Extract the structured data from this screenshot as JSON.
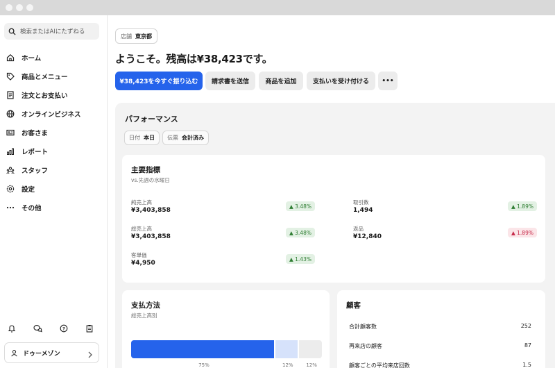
{
  "sidebar": {
    "search_placeholder": "検索またはAIにたずねる",
    "items": [
      {
        "label": "ホーム",
        "icon": "home-icon"
      },
      {
        "label": "商品とメニュー",
        "icon": "tag-icon"
      },
      {
        "label": "注文とお支払い",
        "icon": "receipt-icon"
      },
      {
        "label": "オンラインビジネス",
        "icon": "globe-icon"
      },
      {
        "label": "お客さま",
        "icon": "id-card-icon"
      },
      {
        "label": "レポート",
        "icon": "bar-chart-icon"
      },
      {
        "label": "スタッフ",
        "icon": "team-icon"
      },
      {
        "label": "設定",
        "icon": "gear-icon"
      },
      {
        "label": "その他",
        "icon": "more-icon"
      }
    ],
    "user_name": "ドゥーメゾン"
  },
  "header": {
    "store_key": "店舗",
    "store_value": "東京都",
    "welcome": "ようこそ。残高は¥38,423です。"
  },
  "actions": {
    "primary": "¥38,423を今すぐ振り込む",
    "invoice": "請求書を送信",
    "add_item": "商品を追加",
    "accept_payment": "支払いを受け付ける",
    "more": "•••"
  },
  "performance": {
    "title": "パフォーマンス",
    "filter_date_key": "日付",
    "filter_date_value": "本日",
    "filter_slip_key": "伝票",
    "filter_slip_value": "会計済み"
  },
  "key_metrics": {
    "title": "主要指標",
    "subtitle": "vs.先週の水曜日",
    "metrics": [
      {
        "label": "純売上高",
        "value": "¥3,403,858",
        "change": "▲ 3.48%",
        "trend": "up"
      },
      {
        "label": "取引数",
        "value": "1,494",
        "change": "▲ 1.89%",
        "trend": "up"
      },
      {
        "label": "総売上高",
        "value": "¥3,403,858",
        "change": "▲ 3.48%",
        "trend": "up"
      },
      {
        "label": "返品",
        "value": "¥12,840",
        "change": "▲ 1.89%",
        "trend": "down"
      },
      {
        "label": "客単価",
        "value": "¥4,950",
        "change": "▲ 1.43%",
        "trend": "up"
      }
    ]
  },
  "payment_methods": {
    "title": "支払方法",
    "subtitle": "総売上高別",
    "segments": [
      {
        "label": "75%",
        "share": 75,
        "color": "#2563eb"
      },
      {
        "label": "12%",
        "share": 12,
        "color": "#d6e2fb"
      },
      {
        "label": "12%",
        "share": 12,
        "color": "#ececec"
      }
    ]
  },
  "customers": {
    "title": "顧客",
    "rows": [
      {
        "label": "合計顧客数",
        "value": "252"
      },
      {
        "label": "再来店の顧客",
        "value": "87"
      },
      {
        "label": "顧客ごとの平均来店回数",
        "value": "1.5"
      }
    ]
  },
  "colors": {
    "accent": "#2563eb",
    "up_text": "#2e7d32",
    "up_bg": "#e3f1e4",
    "down_text": "#c62848",
    "down_bg": "#fbe5e8",
    "panel_bg": "#f3f3f3"
  }
}
